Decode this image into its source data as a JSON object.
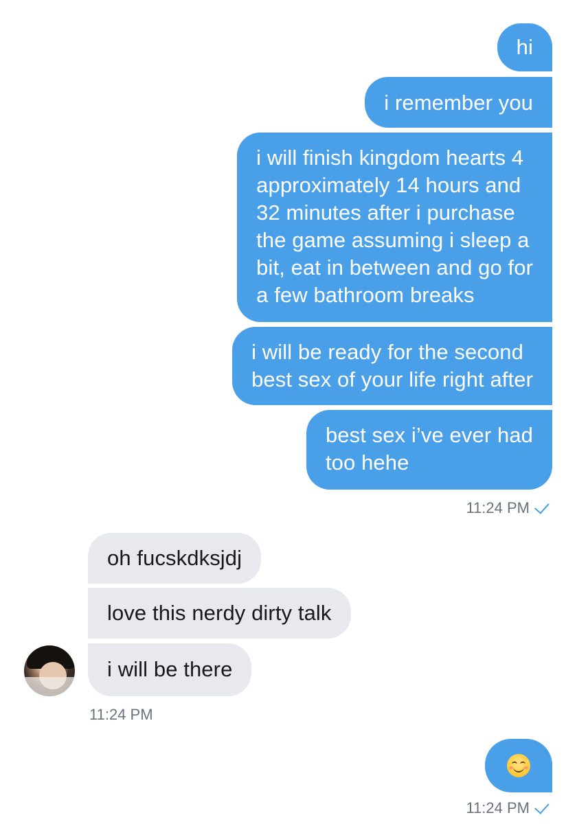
{
  "conversation": {
    "outgoing_group_1": [
      {
        "lines": [
          "hi"
        ]
      },
      {
        "lines": [
          "i remember you"
        ]
      },
      {
        "lines": [
          "i will finish kingdom hearts 4",
          "approximately 14 hours and",
          "32 minutes after i purchase",
          "the game assuming i sleep a",
          "bit, eat in between and go for",
          "a few bathroom breaks"
        ]
      },
      {
        "lines": [
          "i will be ready for the second",
          "best sex of your life right after"
        ]
      },
      {
        "lines": [
          "best sex i’ve ever had",
          "too hehe"
        ]
      }
    ],
    "outgoing_group_1_time": "11:24 PM",
    "incoming_group": [
      {
        "lines": [
          "oh fucskdksjdj"
        ]
      },
      {
        "lines": [
          "love this nerdy dirty talk"
        ]
      },
      {
        "lines": [
          "i will be there"
        ]
      }
    ],
    "incoming_group_time": "11:24 PM",
    "outgoing_group_2": [
      {
        "emoji": "smiling-face-with-smiling-eyes"
      }
    ],
    "outgoing_group_2_time": "11:24 PM"
  },
  "colors": {
    "outgoing_bubble": "#4a9fe9",
    "incoming_bubble": "#e7e9ee",
    "timestamp_text": "#68737d",
    "read_check": "#4a9fe9"
  },
  "icons": {
    "read_receipt": "checkmark-icon",
    "avatar": "user-avatar"
  }
}
